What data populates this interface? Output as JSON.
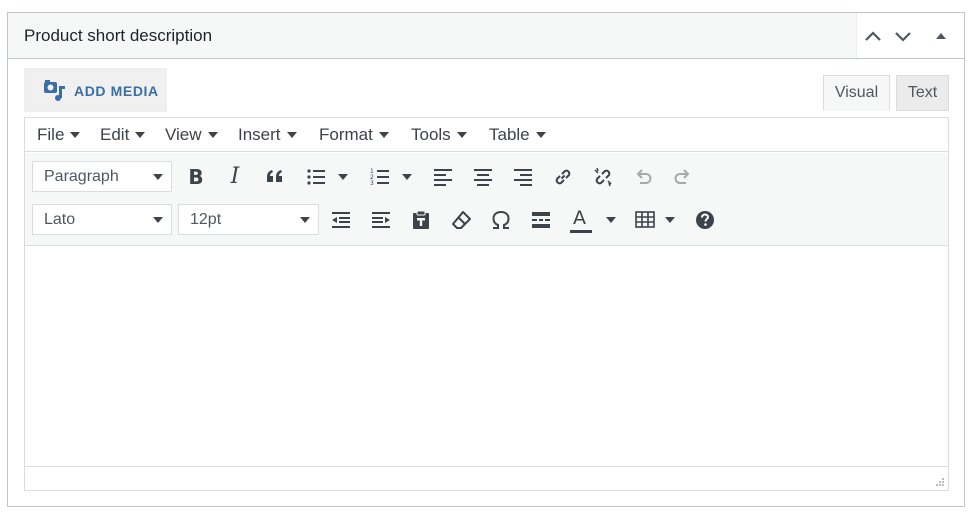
{
  "metabox": {
    "title": "Product short description",
    "handles": {
      "move_up_icon": "chevron-up-icon",
      "move_down_icon": "chevron-down-icon",
      "toggle_icon": "triangle-up-icon"
    }
  },
  "add_media": {
    "label": "ADD MEDIA",
    "icon": "add-media-icon",
    "color": "#3a6ea5"
  },
  "tabs": {
    "visual": "Visual",
    "text": "Text"
  },
  "menubar": {
    "file": "File",
    "edit": "Edit",
    "view": "View",
    "insert": "Insert",
    "format": "Format",
    "tools": "Tools",
    "table": "Table"
  },
  "toolbar": {
    "block_format": "Paragraph",
    "font_family": "Lato",
    "font_size": "12pt",
    "bold_glyph": "B",
    "italic_glyph": "I",
    "text_color_glyph": "A",
    "icons": [
      "bold-icon",
      "italic-icon",
      "blockquote-icon",
      "bullet-list-icon",
      "numbered-list-icon",
      "align-left-icon",
      "align-center-icon",
      "align-right-icon",
      "link-icon",
      "unlink-icon",
      "undo-icon",
      "redo-icon",
      "outdent-icon",
      "indent-icon",
      "paste-as-text-icon",
      "clear-formatting-icon",
      "special-character-icon",
      "horizontal-line-icon",
      "text-color-icon",
      "table-icon",
      "help-icon"
    ]
  },
  "colors": {
    "accent": "#3a6ea5",
    "toolbar_bg": "#f6f7f7",
    "border": "#dcdcde"
  }
}
